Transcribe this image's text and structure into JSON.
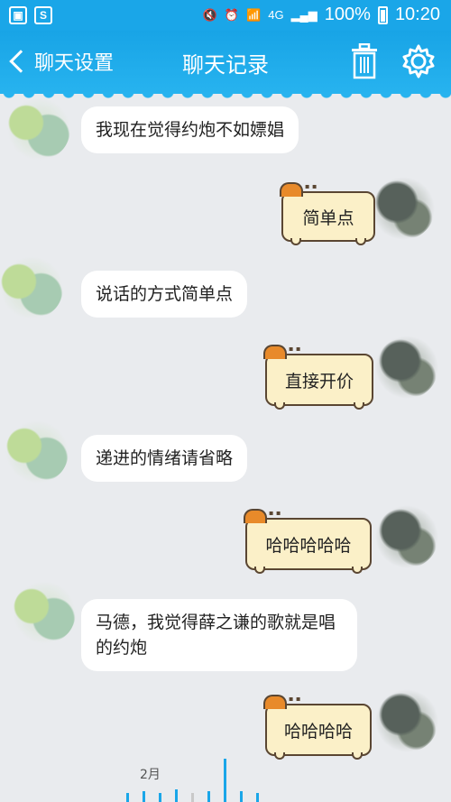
{
  "status_bar": {
    "battery_text": "100%",
    "time": "10:20",
    "network": "4G",
    "icons": [
      "image-icon",
      "s-app-icon",
      "mute-icon",
      "alarm-icon",
      "wifi-icon",
      "signal-icon",
      "battery-icon"
    ]
  },
  "header": {
    "back_label": "聊天设置",
    "title": "聊天记录",
    "trash_icon": "trash-icon",
    "gear_icon": "gear-icon"
  },
  "messages": [
    {
      "side": "left",
      "text": "我现在觉得约炮不如嫖娼"
    },
    {
      "side": "right",
      "text": "简单点"
    },
    {
      "side": "left",
      "text": "说话的方式简单点"
    },
    {
      "side": "right",
      "text": "直接开价"
    },
    {
      "side": "left",
      "text": "递进的情绪请省略"
    },
    {
      "side": "right",
      "text": "哈哈哈哈哈"
    },
    {
      "side": "left",
      "text": "马德，我觉得薛之谦的歌就是唱的约炮"
    },
    {
      "side": "right",
      "text": "哈哈哈哈"
    }
  ],
  "timeline": {
    "month_label": "2月"
  },
  "colors": {
    "accent": "#1aa6e8",
    "right_bubble_fill": "#fbf0c8",
    "right_bubble_border": "#5a4632",
    "left_bubble_fill": "#ffffff"
  }
}
